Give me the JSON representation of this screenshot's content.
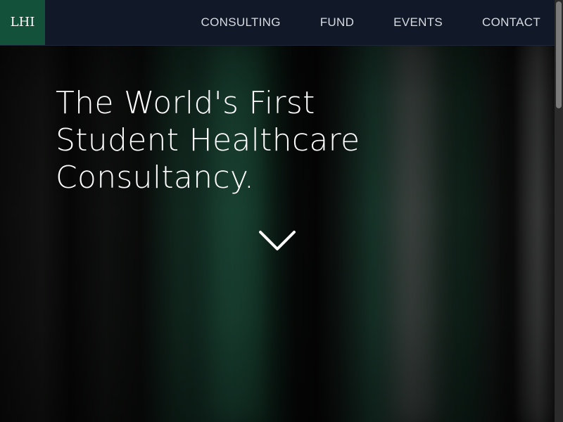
{
  "logo": {
    "text": "LHI"
  },
  "nav": {
    "items": [
      {
        "label": "CONSULTING"
      },
      {
        "label": "FUND"
      },
      {
        "label": "EVENTS"
      },
      {
        "label": "CONTACT"
      }
    ]
  },
  "hero": {
    "headline_lines": [
      "The World's First",
      "Student Healthcare",
      "Consultancy."
    ],
    "scroll_icon": "chevron-down-icon"
  },
  "colors": {
    "navbar_bg": "#111827",
    "logo_bg": "#13513a",
    "nav_text": "#d8dbe2",
    "headline_text": "#ffffff"
  }
}
